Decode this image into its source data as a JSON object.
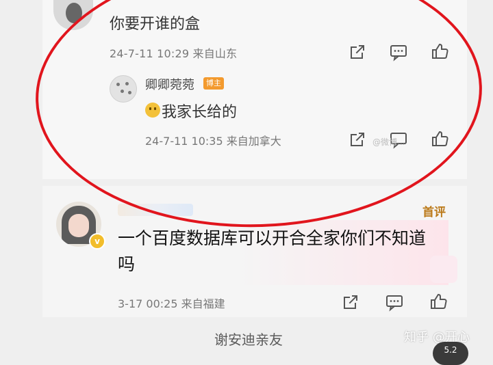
{
  "comment1": {
    "text": "你要开谁的盒",
    "meta": "24-7-11 10:29 来自山东"
  },
  "reply": {
    "name": "卿卿菀菀",
    "badge": "博主",
    "text": "我家长给的",
    "meta": "24-7-11 10:35 来自加拿大",
    "watermark": "@微博..."
  },
  "comment2": {
    "tag": "首评",
    "text": "一个百度数据库可以开合全家你们不知道吗",
    "meta": "3-17 00:25 来自福建"
  },
  "footer": {
    "caption": "谢安迪亲友",
    "site_mark": "知乎 @开心"
  },
  "corner_button": "5.2",
  "colors": {
    "annotation_red": "#e1151d",
    "badge_orange": "#f39a2e",
    "first_tag": "#bb7a1a"
  },
  "icons": [
    "share-icon",
    "comment-icon",
    "like-icon"
  ]
}
